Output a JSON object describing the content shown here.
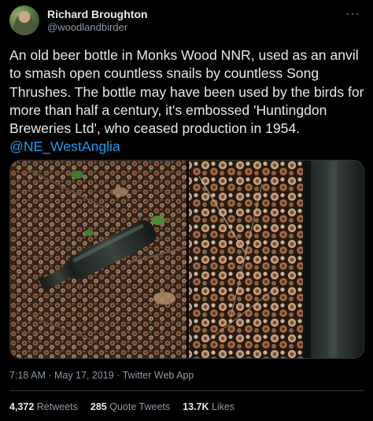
{
  "author": {
    "display_name": "Richard Broughton",
    "handle": "@woodlandbirder",
    "avatar_icon": "avatar-photo"
  },
  "more_icon": "more-options-icon",
  "tweet": {
    "text_before_mention": "An old beer bottle in Monks Wood NNR, used as an anvil to smash open countless snails by countless Song Thrushes. The bottle may have been used by the birds for more than half a century, it's embossed 'Huntingdon Breweries Ltd', who ceased production in 1954. ",
    "mention": "@NE_WestAnglia"
  },
  "media": {
    "left_image": "beer-bottle-among-snail-shells",
    "right_image": "close-up-snail-shells-beside-bottle"
  },
  "meta": {
    "timestamp": "7:18 AM · May 17, 2019 · Twitter Web App"
  },
  "stats": {
    "retweets_count": "4,372",
    "retweets_label": "Retweets",
    "quotes_count": "285",
    "quotes_label": "Quote Tweets",
    "likes_count": "13.7K",
    "likes_label": "Likes"
  },
  "colors": {
    "background": "#000000",
    "text": "#e7e9ea",
    "secondary": "#8b98a5",
    "accent": "#1d9bf0",
    "divider": "#2f3336"
  }
}
